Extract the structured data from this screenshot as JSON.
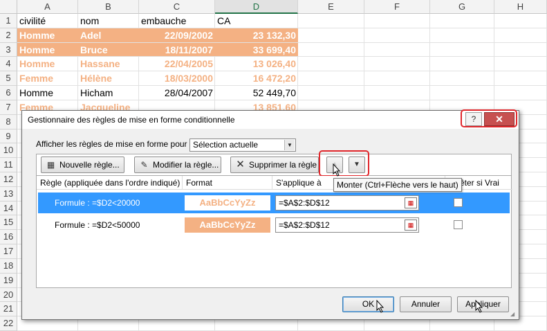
{
  "sheet": {
    "columns": [
      "A",
      "B",
      "C",
      "D",
      "E",
      "F",
      "G",
      "H"
    ],
    "selected_column": "D",
    "rows": [
      {
        "n": "1",
        "a": "civilité",
        "b": "nom",
        "c": "embauche",
        "d": "CA",
        "style": "plain"
      },
      {
        "n": "2",
        "a": "Homme",
        "b": "Adel",
        "c": "22/09/2002",
        "d": "23 132,30",
        "style": "dark"
      },
      {
        "n": "3",
        "a": "Homme",
        "b": "Bruce",
        "c": "18/11/2007",
        "d": "33 699,40",
        "style": "dark"
      },
      {
        "n": "4",
        "a": "Homme",
        "b": "Hassane",
        "c": "22/04/2005",
        "d": "13 026,40",
        "style": "light"
      },
      {
        "n": "5",
        "a": "Femme",
        "b": "Hélène",
        "c": "18/03/2000",
        "d": "16 472,20",
        "style": "light"
      },
      {
        "n": "6",
        "a": "Homme",
        "b": "Hicham",
        "c": "28/04/2007",
        "d": "52 449,70",
        "style": "plain"
      },
      {
        "n": "7",
        "a": "Femme",
        "b": "Jacqueline",
        "c": "",
        "d": "13 851,60",
        "style": "light"
      },
      {
        "n": "8",
        "a": "",
        "b": "",
        "c": "",
        "d": "",
        "style": "plain"
      },
      {
        "n": "9",
        "a": "",
        "b": "",
        "c": "",
        "d": "",
        "style": "plain"
      },
      {
        "n": "10",
        "a": "",
        "b": "",
        "c": "",
        "d": "",
        "style": "plain"
      },
      {
        "n": "11",
        "a": "",
        "b": "",
        "c": "",
        "d": "",
        "style": "plain"
      },
      {
        "n": "12",
        "a": "",
        "b": "",
        "c": "",
        "d": "",
        "style": "plain"
      },
      {
        "n": "13",
        "a": "",
        "b": "",
        "c": "",
        "d": "",
        "style": "plain"
      },
      {
        "n": "14",
        "a": "",
        "b": "",
        "c": "",
        "d": "",
        "style": "plain"
      },
      {
        "n": "15",
        "a": "",
        "b": "",
        "c": "",
        "d": "",
        "style": "plain"
      },
      {
        "n": "16",
        "a": "",
        "b": "",
        "c": "",
        "d": "",
        "style": "plain"
      },
      {
        "n": "17",
        "a": "",
        "b": "",
        "c": "",
        "d": "",
        "style": "plain"
      },
      {
        "n": "18",
        "a": "",
        "b": "",
        "c": "",
        "d": "",
        "style": "plain"
      },
      {
        "n": "19",
        "a": "",
        "b": "",
        "c": "",
        "d": "",
        "style": "plain"
      },
      {
        "n": "20",
        "a": "",
        "b": "",
        "c": "",
        "d": "",
        "style": "plain"
      },
      {
        "n": "21",
        "a": "",
        "b": "",
        "c": "",
        "d": "",
        "style": "plain"
      },
      {
        "n": "22",
        "a": "",
        "b": "",
        "c": "",
        "d": "",
        "style": "plain"
      }
    ],
    "colors": {
      "dark_fill": "#f4b183",
      "light_text": "#f4b183",
      "selected_header": "#217346"
    }
  },
  "dialog": {
    "title": "Gestionnaire des règles de mise en forme conditionnelle",
    "help_label": "?",
    "close_label": "✕",
    "show_rules_label": "Afficher les règles de mise en forme pour :",
    "show_rules_value": "Sélection actuelle",
    "toolbar": {
      "new_rule": "Nouvelle règle...",
      "edit_rule": "Modifier la règle...",
      "delete_rule": "Supprimer la règle",
      "move_up_icon": "▲",
      "move_down_icon": "▼"
    },
    "tooltip": "Monter (Ctrl+Flèche vers le haut)",
    "columns": {
      "rule": "Règle (appliquée dans l'ordre indiqué)",
      "format": "Format",
      "applies_to": "S'applique à",
      "stop_if_true": "Arrêter si Vrai"
    },
    "rules": [
      {
        "formula": "Formule : =$D2<20000",
        "sample": "AaBbCcYyZz",
        "applies": "=$A$2:$D$12",
        "selected": true,
        "sample_style": "text"
      },
      {
        "formula": "Formule : =$D2<50000",
        "sample": "AaBbCcYyZz",
        "applies": "=$A$2:$D$12",
        "selected": false,
        "sample_style": "fill"
      }
    ],
    "buttons": {
      "ok": "OK",
      "cancel": "Annuler",
      "apply": "Appliquer"
    },
    "colors": {
      "selection": "#3399ff",
      "highlight": "#e0262b",
      "sample_fill": "#f4b183",
      "sample_text": "#f4b183"
    }
  }
}
